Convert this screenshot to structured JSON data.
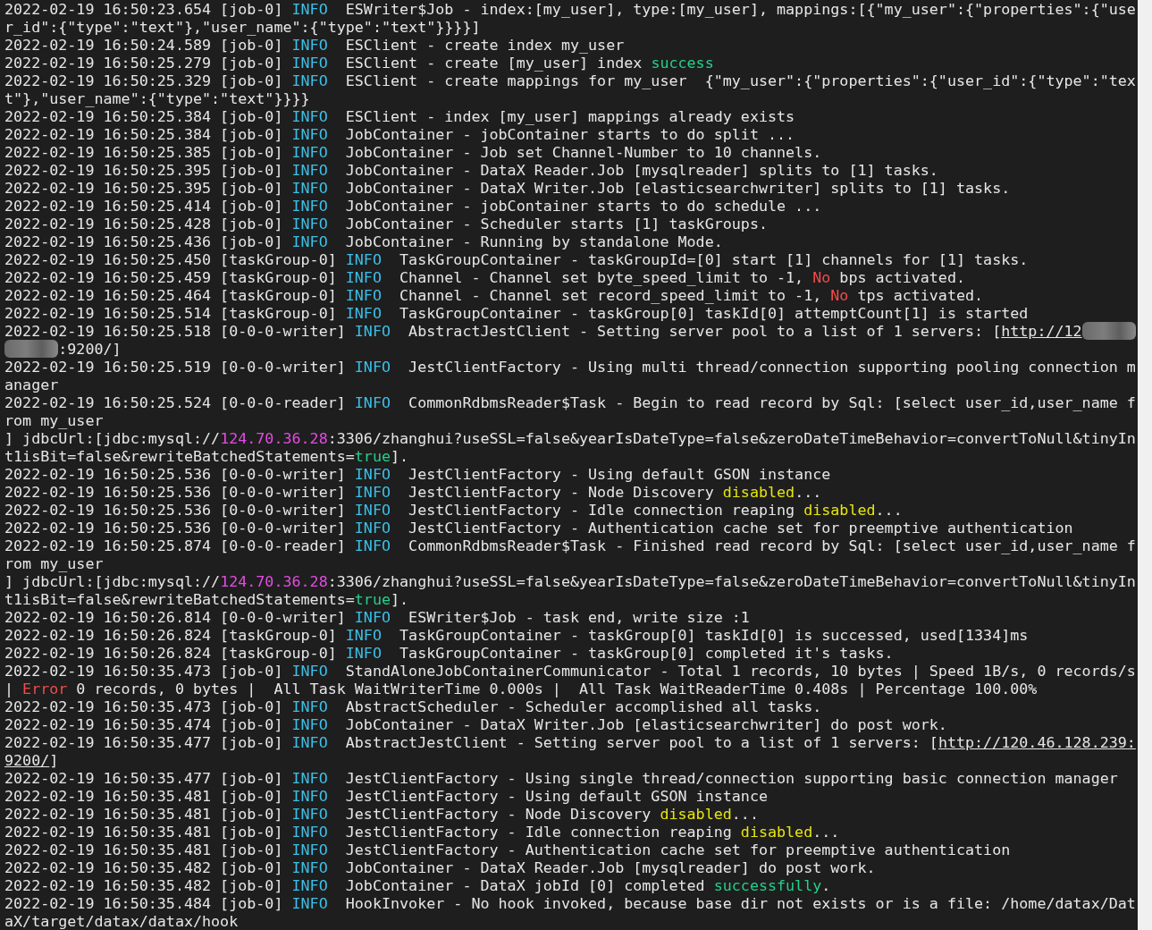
{
  "lines": [
    [
      {
        "text": "2022-02-19 16:50:23.654 [job-0] ",
        "kind": "plain"
      },
      {
        "text": "INFO",
        "kind": "info"
      },
      {
        "text": "  ESWriter$Job - index:[my_user], type:[my_user], mappings:[{\"my_user\":{\"properties\":{\"user_id\":{\"type\":\"text\"},\"user_name\":{\"type\":\"text\"}}}}]",
        "kind": "plain"
      }
    ],
    [
      {
        "text": "2022-02-19 16:50:24.589 [job-0] ",
        "kind": "plain"
      },
      {
        "text": "INFO",
        "kind": "info"
      },
      {
        "text": "  ESClient - create index my_user",
        "kind": "plain"
      }
    ],
    [
      {
        "text": "2022-02-19 16:50:25.279 [job-0] ",
        "kind": "plain"
      },
      {
        "text": "INFO",
        "kind": "info"
      },
      {
        "text": "  ESClient - create [my_user] index ",
        "kind": "plain"
      },
      {
        "text": "success",
        "kind": "success"
      }
    ],
    [
      {
        "text": "2022-02-19 16:50:25.329 [job-0] ",
        "kind": "plain"
      },
      {
        "text": "INFO",
        "kind": "info"
      },
      {
        "text": "  ESClient - create mappings for my_user  {\"my_user\":{\"properties\":{\"user_id\":{\"type\":\"text\"},\"user_name\":{\"type\":\"text\"}}}}",
        "kind": "plain"
      }
    ],
    [
      {
        "text": "2022-02-19 16:50:25.384 [job-0] ",
        "kind": "plain"
      },
      {
        "text": "INFO",
        "kind": "info"
      },
      {
        "text": "  ESClient - index [my_user] mappings already exists",
        "kind": "plain"
      }
    ],
    [
      {
        "text": "2022-02-19 16:50:25.384 [job-0] ",
        "kind": "plain"
      },
      {
        "text": "INFO",
        "kind": "info"
      },
      {
        "text": "  JobContainer - jobContainer starts to do split ...",
        "kind": "plain"
      }
    ],
    [
      {
        "text": "2022-02-19 16:50:25.385 [job-0] ",
        "kind": "plain"
      },
      {
        "text": "INFO",
        "kind": "info"
      },
      {
        "text": "  JobContainer - Job set Channel-Number to 10 channels.",
        "kind": "plain"
      }
    ],
    [
      {
        "text": "2022-02-19 16:50:25.395 [job-0] ",
        "kind": "plain"
      },
      {
        "text": "INFO",
        "kind": "info"
      },
      {
        "text": "  JobContainer - DataX Reader.Job [mysqlreader] splits to [1] tasks.",
        "kind": "plain"
      }
    ],
    [
      {
        "text": "2022-02-19 16:50:25.395 [job-0] ",
        "kind": "plain"
      },
      {
        "text": "INFO",
        "kind": "info"
      },
      {
        "text": "  JobContainer - DataX Writer.Job [elasticsearchwriter] splits to [1] tasks.",
        "kind": "plain"
      }
    ],
    [
      {
        "text": "2022-02-19 16:50:25.414 [job-0] ",
        "kind": "plain"
      },
      {
        "text": "INFO",
        "kind": "info"
      },
      {
        "text": "  JobContainer - jobContainer starts to do schedule ...",
        "kind": "plain"
      }
    ],
    [
      {
        "text": "2022-02-19 16:50:25.428 [job-0] ",
        "kind": "plain"
      },
      {
        "text": "INFO",
        "kind": "info"
      },
      {
        "text": "  JobContainer - Scheduler starts [1] taskGroups.",
        "kind": "plain"
      }
    ],
    [
      {
        "text": "2022-02-19 16:50:25.436 [job-0] ",
        "kind": "plain"
      },
      {
        "text": "INFO",
        "kind": "info"
      },
      {
        "text": "  JobContainer - Running by standalone Mode.",
        "kind": "plain"
      }
    ],
    [
      {
        "text": "2022-02-19 16:50:25.450 [taskGroup-0] ",
        "kind": "plain"
      },
      {
        "text": "INFO",
        "kind": "info"
      },
      {
        "text": "  TaskGroupContainer - taskGroupId=[0] start [1] channels for [1] tasks.",
        "kind": "plain"
      }
    ],
    [
      {
        "text": "2022-02-19 16:50:25.459 [taskGroup-0] ",
        "kind": "plain"
      },
      {
        "text": "INFO",
        "kind": "info"
      },
      {
        "text": "  Channel - Channel set byte_speed_limit to -1, ",
        "kind": "plain"
      },
      {
        "text": "No",
        "kind": "error"
      },
      {
        "text": " bps activated.",
        "kind": "plain"
      }
    ],
    [
      {
        "text": "2022-02-19 16:50:25.464 [taskGroup-0] ",
        "kind": "plain"
      },
      {
        "text": "INFO",
        "kind": "info"
      },
      {
        "text": "  Channel - Channel set record_speed_limit to -1, ",
        "kind": "plain"
      },
      {
        "text": "No",
        "kind": "error"
      },
      {
        "text": " tps activated.",
        "kind": "plain"
      }
    ],
    [
      {
        "text": "2022-02-19 16:50:25.514 [taskGroup-0] ",
        "kind": "plain"
      },
      {
        "text": "INFO",
        "kind": "info"
      },
      {
        "text": "  TaskGroupContainer - taskGroup[0] taskId[0] attemptCount[1] is started",
        "kind": "plain"
      }
    ],
    [
      {
        "text": "2022-02-19 16:50:25.518 [0-0-0-writer] ",
        "kind": "plain"
      },
      {
        "text": "INFO",
        "kind": "info"
      },
      {
        "text": "  AbstractJestClient - Setting server pool to a list of 1 servers: [",
        "kind": "plain"
      },
      {
        "text": "http://12",
        "kind": "link"
      },
      {
        "kind": "redacted"
      },
      {
        "kind": "redacted"
      },
      {
        "text": ":9200/]",
        "kind": "plain"
      }
    ],
    [
      {
        "text": "2022-02-19 16:50:25.519 [0-0-0-writer] ",
        "kind": "plain"
      },
      {
        "text": "INFO",
        "kind": "info"
      },
      {
        "text": "  JestClientFactory - Using multi thread/connection supporting pooling connection manager",
        "kind": "plain"
      }
    ],
    [
      {
        "text": "2022-02-19 16:50:25.524 [0-0-0-reader] ",
        "kind": "plain"
      },
      {
        "text": "INFO",
        "kind": "info"
      },
      {
        "text": "  CommonRdbmsReader$Task - Begin to read record by Sql: [select user_id,user_name from my_user\n] jdbcUrl:[jdbc:mysql://",
        "kind": "plain"
      },
      {
        "text": "124.70.36.28",
        "kind": "ip"
      },
      {
        "text": ":3306/zhanghui?useSSL=false&yearIsDateType=false&zeroDateTimeBehavior=convertToNull&tinyInt1isBit=false&rewriteBatchedStatements=",
        "kind": "plain"
      },
      {
        "text": "true",
        "kind": "success"
      },
      {
        "text": "].",
        "kind": "plain"
      }
    ],
    [
      {
        "text": "2022-02-19 16:50:25.536 [0-0-0-writer] ",
        "kind": "plain"
      },
      {
        "text": "INFO",
        "kind": "info"
      },
      {
        "text": "  JestClientFactory - Using default GSON instance",
        "kind": "plain"
      }
    ],
    [
      {
        "text": "2022-02-19 16:50:25.536 [0-0-0-writer] ",
        "kind": "plain"
      },
      {
        "text": "INFO",
        "kind": "info"
      },
      {
        "text": "  JestClientFactory - Node Discovery ",
        "kind": "plain"
      },
      {
        "text": "disabled",
        "kind": "warn"
      },
      {
        "text": "...",
        "kind": "plain"
      }
    ],
    [
      {
        "text": "2022-02-19 16:50:25.536 [0-0-0-writer] ",
        "kind": "plain"
      },
      {
        "text": "INFO",
        "kind": "info"
      },
      {
        "text": "  JestClientFactory - Idle connection reaping ",
        "kind": "plain"
      },
      {
        "text": "disabled",
        "kind": "warn"
      },
      {
        "text": "...",
        "kind": "plain"
      }
    ],
    [
      {
        "text": "2022-02-19 16:50:25.536 [0-0-0-writer] ",
        "kind": "plain"
      },
      {
        "text": "INFO",
        "kind": "info"
      },
      {
        "text": "  JestClientFactory - Authentication cache set for preemptive authentication",
        "kind": "plain"
      }
    ],
    [
      {
        "text": "2022-02-19 16:50:25.874 [0-0-0-reader] ",
        "kind": "plain"
      },
      {
        "text": "INFO",
        "kind": "info"
      },
      {
        "text": "  CommonRdbmsReader$Task - Finished read record by Sql: [select user_id,user_name from my_user\n] jdbcUrl:[jdbc:mysql://",
        "kind": "plain"
      },
      {
        "text": "124.70.36.28",
        "kind": "ip"
      },
      {
        "text": ":3306/zhanghui?useSSL=false&yearIsDateType=false&zeroDateTimeBehavior=convertToNull&tinyInt1isBit=false&rewriteBatchedStatements=",
        "kind": "plain"
      },
      {
        "text": "true",
        "kind": "success"
      },
      {
        "text": "].",
        "kind": "plain"
      }
    ],
    [
      {
        "text": "2022-02-19 16:50:26.814 [0-0-0-writer] ",
        "kind": "plain"
      },
      {
        "text": "INFO",
        "kind": "info"
      },
      {
        "text": "  ESWriter$Job - task end, write size :1",
        "kind": "plain"
      }
    ],
    [
      {
        "text": "2022-02-19 16:50:26.824 [taskGroup-0] ",
        "kind": "plain"
      },
      {
        "text": "INFO",
        "kind": "info"
      },
      {
        "text": "  TaskGroupContainer - taskGroup[0] taskId[0] is successed, used[1334]ms",
        "kind": "plain"
      }
    ],
    [
      {
        "text": "2022-02-19 16:50:26.824 [taskGroup-0] ",
        "kind": "plain"
      },
      {
        "text": "INFO",
        "kind": "info"
      },
      {
        "text": "  TaskGroupContainer - taskGroup[0] completed it's tasks.",
        "kind": "plain"
      }
    ],
    [
      {
        "text": "2022-02-19 16:50:35.473 [job-0] ",
        "kind": "plain"
      },
      {
        "text": "INFO",
        "kind": "info"
      },
      {
        "text": "  StandAloneJobContainerCommunicator - Total 1 records, 10 bytes | Speed 1B/s, 0 records/s | ",
        "kind": "plain"
      },
      {
        "text": "Error",
        "kind": "error"
      },
      {
        "text": " 0 records, 0 bytes |  All Task WaitWriterTime 0.000s |  All Task WaitReaderTime 0.408s | Percentage 100.00%",
        "kind": "plain"
      }
    ],
    [
      {
        "text": "2022-02-19 16:50:35.473 [job-0] ",
        "kind": "plain"
      },
      {
        "text": "INFO",
        "kind": "info"
      },
      {
        "text": "  AbstractScheduler - Scheduler accomplished all tasks.",
        "kind": "plain"
      }
    ],
    [
      {
        "text": "2022-02-19 16:50:35.474 [job-0] ",
        "kind": "plain"
      },
      {
        "text": "INFO",
        "kind": "info"
      },
      {
        "text": "  JobContainer - DataX Writer.Job [elasticsearchwriter] do post work.",
        "kind": "plain"
      }
    ],
    [
      {
        "text": "2022-02-19 16:50:35.477 [job-0] ",
        "kind": "plain"
      },
      {
        "text": "INFO",
        "kind": "info"
      },
      {
        "text": "  AbstractJestClient - Setting server pool to a list of 1 servers: [",
        "kind": "plain"
      },
      {
        "text": "http://120.46.128.239:",
        "kind": "link"
      },
      {
        "text": "9200/",
        "kind": "link"
      },
      {
        "text": "]",
        "kind": "plain"
      }
    ],
    [
      {
        "text": "2022-02-19 16:50:35.477 [job-0] ",
        "kind": "plain"
      },
      {
        "text": "INFO",
        "kind": "info"
      },
      {
        "text": "  JestClientFactory - Using single thread/connection supporting basic connection manager",
        "kind": "plain"
      }
    ],
    [
      {
        "text": "2022-02-19 16:50:35.481 [job-0] ",
        "kind": "plain"
      },
      {
        "text": "INFO",
        "kind": "info"
      },
      {
        "text": "  JestClientFactory - Using default GSON instance",
        "kind": "plain"
      }
    ],
    [
      {
        "text": "2022-02-19 16:50:35.481 [job-0] ",
        "kind": "plain"
      },
      {
        "text": "INFO",
        "kind": "info"
      },
      {
        "text": "  JestClientFactory - Node Discovery ",
        "kind": "plain"
      },
      {
        "text": "disabled",
        "kind": "warn"
      },
      {
        "text": "...",
        "kind": "plain"
      }
    ],
    [
      {
        "text": "2022-02-19 16:50:35.481 [job-0] ",
        "kind": "plain"
      },
      {
        "text": "INFO",
        "kind": "info"
      },
      {
        "text": "  JestClientFactory - Idle connection reaping ",
        "kind": "plain"
      },
      {
        "text": "disabled",
        "kind": "warn"
      },
      {
        "text": "...",
        "kind": "plain"
      }
    ],
    [
      {
        "text": "2022-02-19 16:50:35.481 [job-0] ",
        "kind": "plain"
      },
      {
        "text": "INFO",
        "kind": "info"
      },
      {
        "text": "  JestClientFactory - Authentication cache set for preemptive authentication",
        "kind": "plain"
      }
    ],
    [
      {
        "text": "2022-02-19 16:50:35.482 [job-0] ",
        "kind": "plain"
      },
      {
        "text": "INFO",
        "kind": "info"
      },
      {
        "text": "  JobContainer - DataX Reader.Job [mysqlreader] do post work.",
        "kind": "plain"
      }
    ],
    [
      {
        "text": "2022-02-19 16:50:35.482 [job-0] ",
        "kind": "plain"
      },
      {
        "text": "INFO",
        "kind": "info"
      },
      {
        "text": "  JobContainer - DataX jobId [0] completed ",
        "kind": "plain"
      },
      {
        "text": "successfully",
        "kind": "success"
      },
      {
        "text": ".",
        "kind": "plain"
      }
    ],
    [
      {
        "text": "2022-02-19 16:50:35.484 [job-0] ",
        "kind": "plain"
      },
      {
        "text": "INFO",
        "kind": "info"
      },
      {
        "text": "  HookInvoker - No hook invoked, because base dir not exists or is a file: /home/datax/DataX/target/datax/datax/hook",
        "kind": "plain"
      }
    ]
  ]
}
